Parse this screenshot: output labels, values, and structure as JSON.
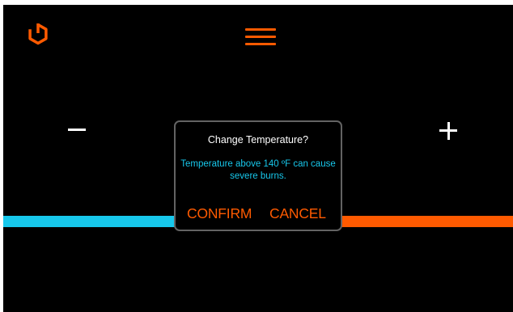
{
  "colors": {
    "accent_orange": "#ff5a00",
    "accent_cyan": "#17c8ec",
    "background": "#000000",
    "dialog_border": "#636363",
    "text_white": "#ffffff"
  },
  "header": {
    "power_icon": "power-icon",
    "menu_icon": "hamburger-menu-icon"
  },
  "controls": {
    "decrease_icon": "minus-icon",
    "increase_icon": "plus-icon"
  },
  "dialog": {
    "title": "Change Temperature?",
    "warning": "Temperature above 140 ºF can cause severe burns.",
    "confirm_label": "CONFIRM",
    "cancel_label": "CANCEL"
  }
}
